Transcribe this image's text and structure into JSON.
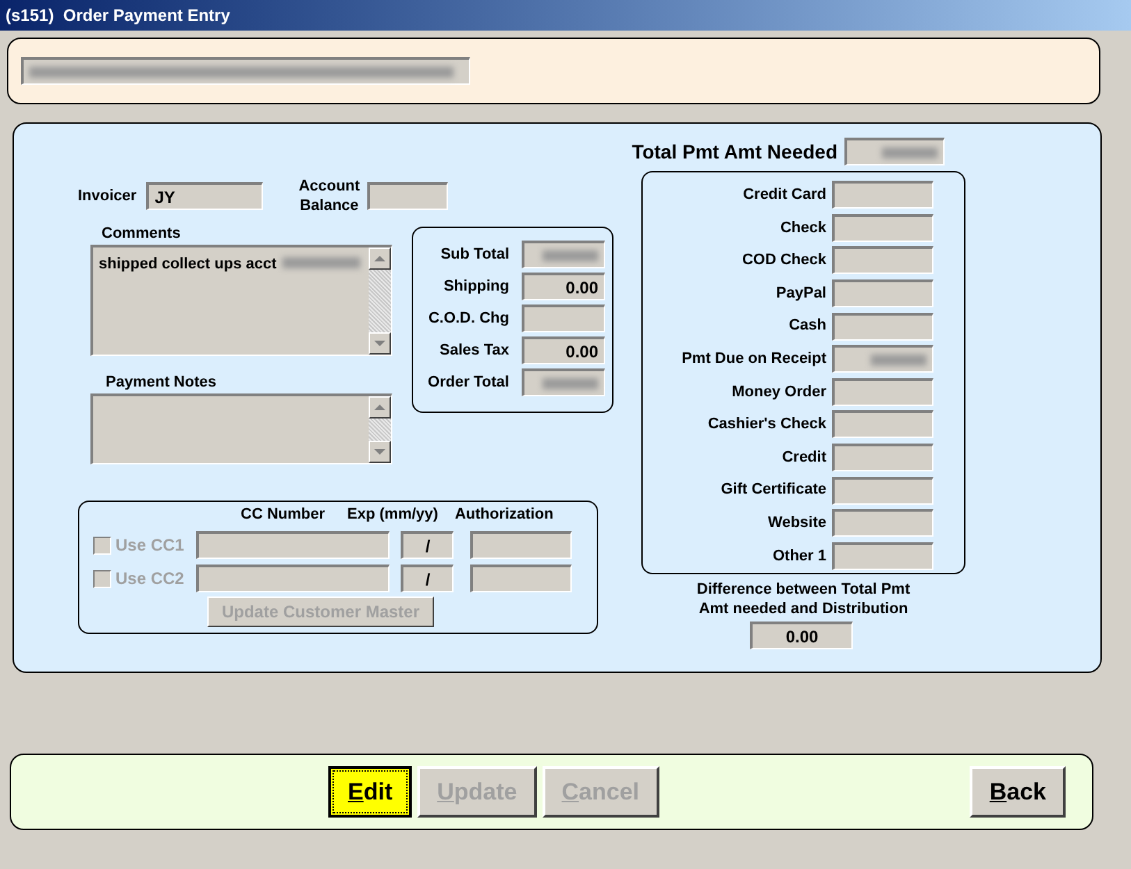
{
  "window": {
    "title": "(s151)  Order Payment Entry"
  },
  "header_field": {
    "redacted": true
  },
  "total_needed": {
    "label": "Total Pmt Amt Needed",
    "redacted": true
  },
  "invoicer": {
    "label": "Invoicer",
    "value": "JY"
  },
  "account_balance": {
    "label": "Account Balance"
  },
  "comments": {
    "label": "Comments",
    "value": "shipped collect ups acct",
    "redacted_tail": true
  },
  "payment_notes": {
    "label": "Payment Notes"
  },
  "summary": [
    {
      "label": "Sub Total",
      "redacted": true
    },
    {
      "label": "Shipping",
      "value": "0.00"
    },
    {
      "label": "C.O.D. Chg"
    },
    {
      "label": "Sales Tax",
      "value": "0.00"
    },
    {
      "label": "Order Total",
      "redacted": true
    }
  ],
  "payments": [
    {
      "label": "Credit Card"
    },
    {
      "label": "Check"
    },
    {
      "label": "COD Check"
    },
    {
      "label": "PayPal"
    },
    {
      "label": "Cash"
    },
    {
      "label": "Pmt Due on Receipt",
      "redacted": true
    },
    {
      "label": "Money Order"
    },
    {
      "label": "Cashier's Check"
    },
    {
      "label": "Credit"
    },
    {
      "label": "Gift Certificate"
    },
    {
      "label": "Website"
    },
    {
      "label": "Other 1"
    }
  ],
  "difference": {
    "label": "Difference between Total Pmt Amt needed and Distribution",
    "value": "0.00"
  },
  "credit_cards": {
    "columns": [
      "CC Number",
      "Exp (mm/yy)",
      "Authorization"
    ],
    "rows": [
      {
        "label": "Use CC1",
        "checked": false,
        "disabled": true,
        "exp": "/"
      },
      {
        "label": "Use CC2",
        "checked": false,
        "disabled": true,
        "exp": "/"
      }
    ],
    "update_button": {
      "label": "Update Customer Master",
      "disabled": true
    }
  },
  "actions": [
    {
      "label": "Edit",
      "underline_first": true,
      "focused": true,
      "disabled": false
    },
    {
      "label": "Update",
      "underline_first": true,
      "focused": false,
      "disabled": true
    },
    {
      "label": "Cancel",
      "underline_first": true,
      "focused": false,
      "disabled": true
    }
  ],
  "back_button": {
    "label": "Back",
    "underline_first": true,
    "focused": false,
    "disabled": false
  }
}
